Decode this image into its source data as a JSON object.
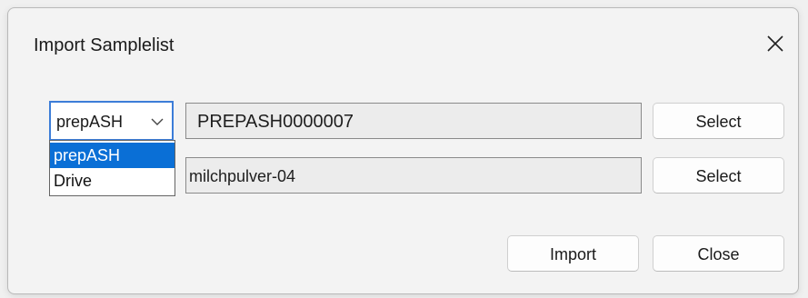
{
  "dialog": {
    "title": "Import Samplelist",
    "close_icon": "close-icon"
  },
  "source": {
    "selected": "prepASH",
    "options": [
      "prepASH",
      "Drive"
    ],
    "highlighted_option": "prepASH"
  },
  "row1": {
    "value": "PREPASH0000007",
    "button_label": "Select"
  },
  "row2": {
    "value": "milchpulver-04",
    "button_label": "Select"
  },
  "footer": {
    "import_label": "Import",
    "close_label": "Close"
  },
  "colors": {
    "accent": "#0a6fd6",
    "focus_border": "#3c7dd8"
  }
}
